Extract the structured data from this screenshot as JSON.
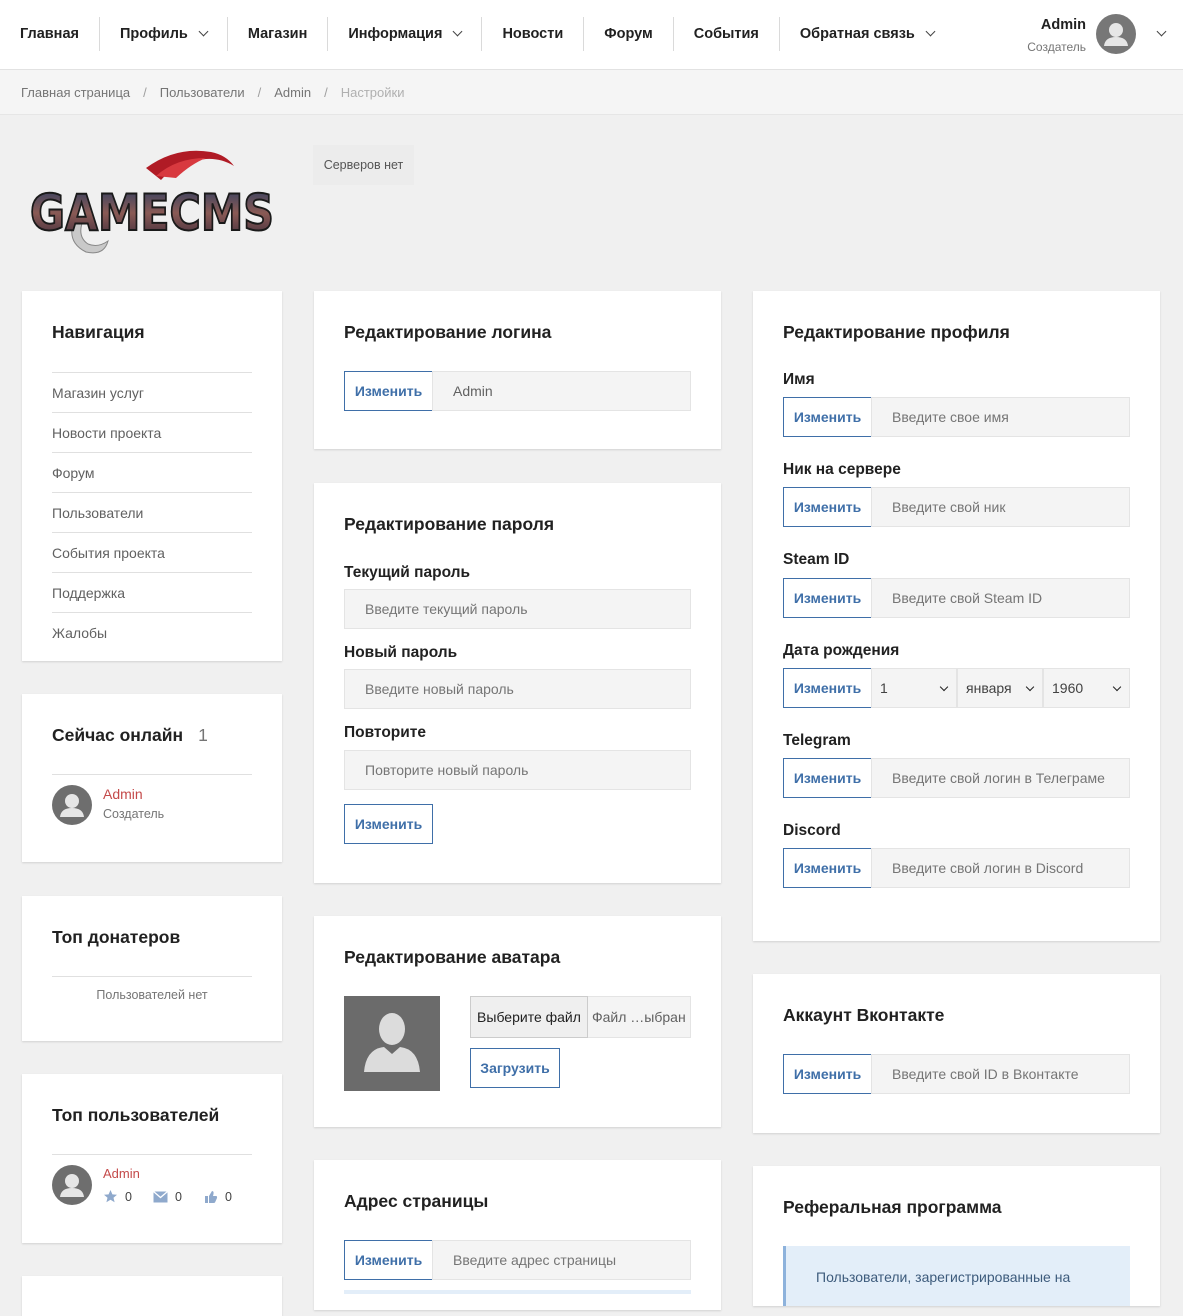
{
  "nav": {
    "items": [
      {
        "label": "Главная",
        "has_dropdown": false
      },
      {
        "label": "Профиль",
        "has_dropdown": true
      },
      {
        "label": "Магазин",
        "has_dropdown": false
      },
      {
        "label": "Информация",
        "has_dropdown": true
      },
      {
        "label": "Новости",
        "has_dropdown": false
      },
      {
        "label": "Форум",
        "has_dropdown": false
      },
      {
        "label": "События",
        "has_dropdown": false
      },
      {
        "label": "Обратная связь",
        "has_dropdown": true
      }
    ],
    "user": {
      "name": "Admin",
      "role": "Создатель"
    }
  },
  "breadcrumb": [
    "Главная страница",
    "Пользователи",
    "Admin",
    "Настройки"
  ],
  "logo_text": "GAMECMS",
  "servers_label": "Серверов нет",
  "sidebar": {
    "navigation": {
      "title": "Навигация",
      "items": [
        "Магазин услуг",
        "Новости проекта",
        "Форум",
        "Пользователи",
        "События проекта",
        "Поддержка",
        "Жалобы"
      ]
    },
    "online": {
      "title": "Сейчас онлайн",
      "count": "1",
      "user_name": "Admin",
      "user_role": "Создатель"
    },
    "donators": {
      "title": "Топ донатеров",
      "empty": "Пользователей нет"
    },
    "top_users": {
      "title": "Топ пользователей",
      "user_name": "Admin",
      "stars": "0",
      "messages": "0",
      "thanks": "0"
    }
  },
  "login_card": {
    "title": "Редактирование логина",
    "button": "Изменить",
    "value": "Admin"
  },
  "password_card": {
    "title": "Редактирование пароля",
    "current_label": "Текущий пароль",
    "current_placeholder": "Введите текущий пароль",
    "new_label": "Новый пароль",
    "new_placeholder": "Введите новый пароль",
    "repeat_label": "Повторите",
    "repeat_placeholder": "Повторите новый пароль",
    "button": "Изменить"
  },
  "avatar_card": {
    "title": "Редактирование аватара",
    "file_button": "Выберите файл",
    "file_status": "Файл …ыбран",
    "upload_button": "Загрузить"
  },
  "address_card": {
    "title": "Адрес страницы",
    "button": "Изменить",
    "placeholder": "Введите адрес страницы"
  },
  "profile_card": {
    "title": "Редактирование профиля",
    "button": "Изменить",
    "name_label": "Имя",
    "name_placeholder": "Введите свое имя",
    "nick_label": "Ник на сервере",
    "nick_placeholder": "Введите свой ник",
    "steam_label": "Steam ID",
    "steam_placeholder": "Введите свой Steam ID",
    "birth_label": "Дата рождения",
    "birth_day": "1",
    "birth_month": "января",
    "birth_year": "1960",
    "telegram_label": "Telegram",
    "telegram_placeholder": "Введите свой логин в Телеграме",
    "discord_label": "Discord",
    "discord_placeholder": "Введите свой логин в Discord"
  },
  "vk_card": {
    "title": "Аккаунт Вконтакте",
    "button": "Изменить",
    "placeholder": "Введите свой ID в Вконтакте"
  },
  "referral_card": {
    "title": "Реферальная программа",
    "text": "Пользователи, зарегистрированные на"
  }
}
